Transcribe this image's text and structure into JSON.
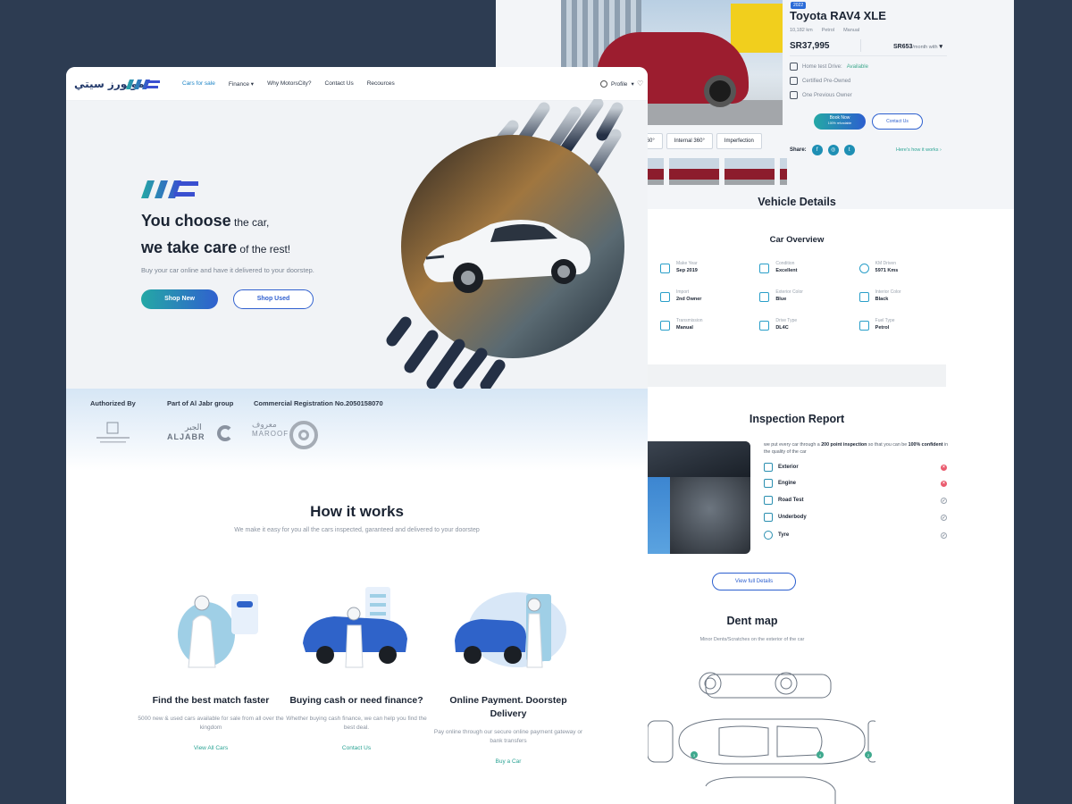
{
  "listing": {
    "year_badge": "2022",
    "title": "Toyota RAV4 XLE",
    "specs": [
      "10,182 km",
      "Petrol",
      "Manual"
    ],
    "price": "SR37,995",
    "monthly_price": "SR653",
    "monthly_suffix": "/month with",
    "features": [
      {
        "label": "Home test Drive:",
        "value": "Available"
      },
      {
        "label": "Certified Pre-Owned",
        "value": ""
      },
      {
        "label": "One Previous Owner",
        "value": ""
      }
    ],
    "book_now": "Book Now",
    "book_sub": "100% refundable",
    "contact_us": "Contact Us",
    "view_tabs": [
      "al 360°",
      "Internal 360°",
      "Imperfection"
    ],
    "share_label": "Share:",
    "how_it_works_link": "Here's how it works ›"
  },
  "vehicle_details": {
    "heading": "Vehicle Details",
    "overview_heading": "Car Overview",
    "overview": [
      {
        "label": "Make Year",
        "value": "Sep 2019"
      },
      {
        "label": "Condition",
        "value": "Excellent"
      },
      {
        "label": "KM Driven",
        "value": "5971 Kms"
      },
      {
        "label": "Import",
        "value": "2nd Owner"
      },
      {
        "label": "Exterior Color",
        "value": "Blue"
      },
      {
        "label": "Interior Color",
        "value": "Black"
      },
      {
        "label": "Transmission",
        "value": "Manual"
      },
      {
        "label": "Drive Type",
        "value": "DL4C"
      },
      {
        "label": "Fuel Type",
        "value": "Petrol"
      }
    ]
  },
  "inspection": {
    "heading": "Inspection Report",
    "desc_pre": "we put every car through a ",
    "desc_bold": "200 point inspection",
    "desc_mid": " so that you can be ",
    "desc_bold2": "100% confident",
    "desc_post": " in the quality of the car",
    "items": [
      {
        "label": "Exterior",
        "status": "issue"
      },
      {
        "label": "Engine",
        "status": "issue"
      },
      {
        "label": "Road Test",
        "status": "ok"
      },
      {
        "label": "Underbody",
        "status": "ok"
      },
      {
        "label": "Tyre",
        "status": "ok"
      }
    ],
    "view_full": "View full Details"
  },
  "dent_map": {
    "heading": "Dent map",
    "subtitle": "Minor Dents/Scratches on the exterior of the car",
    "markers": [
      "3",
      "4",
      "2"
    ]
  },
  "nav": {
    "logo_arabic": "موتورز سيتي",
    "links": [
      "Cars for sale",
      "Finance",
      "Why MotorsCity?",
      "Contact Us",
      "Recources"
    ],
    "profile": "Profile"
  },
  "hero": {
    "line1_bold": "You choose",
    "line1_rest": " the car,",
    "line2_bold": "we take care",
    "line2_rest": " of the rest!",
    "subtitle": "Buy your car online and have it delivered to your doorstep.",
    "shop_new": "Shop New",
    "shop_used": "Shop Used"
  },
  "authority": {
    "authorized_by": "Authorized By",
    "part_of": "Part of Al Jabr group",
    "commercial": "Commercial Registration No.2050158070",
    "aljabr_ar": "الجبر",
    "aljabr_en": "ALJABR",
    "maroof_ar": "معروف",
    "maroof_en": "MAROOF"
  },
  "how_it_works": {
    "heading": "How it works",
    "subtitle": "We make it easy for you all the cars inspected, garanteed and delivered to your doorstep",
    "steps": [
      {
        "title": "Find the best match faster",
        "text": "5000 new & used cars available for sale from all over the kingdom",
        "link": "View All Cars"
      },
      {
        "title": "Buying cash or need finance?",
        "text": "Whether buying cash finance, we can help you find the best deal.",
        "link": "Contact Us"
      },
      {
        "title": "Online Payment. Doorstep Delivery",
        "text": "Pay online through our secure online payment gateway or bank transfers",
        "link": "Buy a Car"
      }
    ]
  },
  "colors": {
    "brand_blue": "#2c5fcf",
    "brand_teal": "#24a8a5",
    "background": "#2d3c52"
  }
}
